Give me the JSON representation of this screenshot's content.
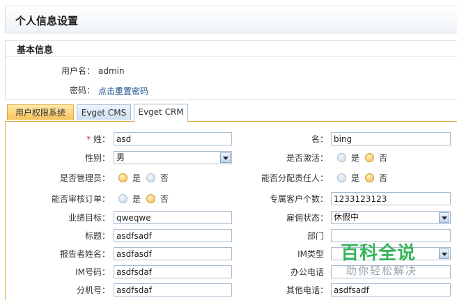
{
  "page": {
    "title": "个人信息设置"
  },
  "basic": {
    "title": "基本信息",
    "username_label": "用户名：",
    "username_value": "admin",
    "password_label": "密码：",
    "password_link": "点击重置密码"
  },
  "tabs": [
    {
      "label": "用户权限系统",
      "active": false
    },
    {
      "label": "Evget CMS",
      "active": false
    },
    {
      "label": "Evget CRM",
      "active": true
    }
  ],
  "form": {
    "surname_label": "姓：",
    "surname_value": "asd",
    "given_label": "名：",
    "given_value": "bing",
    "gender_label": "性别：",
    "gender_value": "男",
    "active_label": "是否激活：",
    "admin_label": "是否管理员：",
    "assign_label": "能否分配责任人：",
    "audit_label": "能否审核订单：",
    "clients_label": "专属客户个数：",
    "clients_value": "1233123123",
    "target_label": "业绩目标：",
    "target_value": "qweqwe",
    "employ_label": "雇佣状态：",
    "employ_value": "休假中",
    "headline_label": "标题：",
    "headline_value": "asdfsadf",
    "dept_label": "部门",
    "reporter_label": "报告者姓名：",
    "reporter_value": "asdfasdf",
    "imtype_label": "IM类型",
    "imno_label": "IM号码：",
    "imno_value": "asdfsdaf",
    "officephone_label": "办公电话",
    "ext_label": "分机号：",
    "ext_value": "asdfsdaf",
    "otherphone_label": "其他电话：",
    "otherphone_value": "asdfsadf",
    "yes": "是",
    "no": "否",
    "required_mark": "*"
  },
  "watermark": {
    "line1": "百科全说",
    "line2": "助你轻松解决"
  },
  "colors": {
    "tab_active": "#f6c25a",
    "link": "#1a4f8b",
    "radio_on": "#f0b64a",
    "radio_off": "#c6d6e6"
  }
}
